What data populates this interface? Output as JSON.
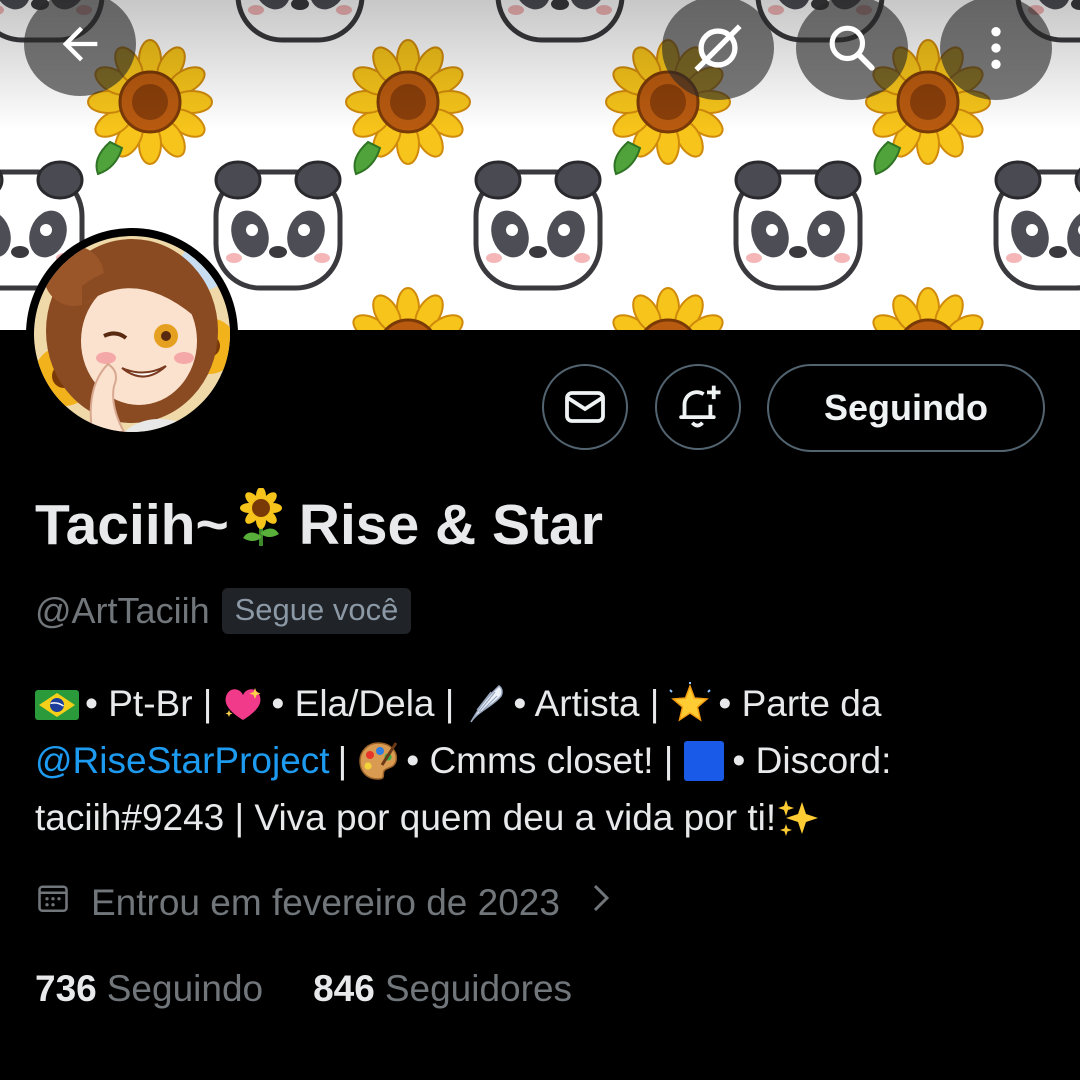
{
  "header": {
    "back_icon": "arrow-left-icon",
    "spaces_icon": "spaces-icon",
    "search_icon": "search-icon",
    "more_icon": "more-vertical-icon"
  },
  "banner": {
    "pattern": [
      "panda",
      "sunflower"
    ],
    "background": "#ffffff"
  },
  "profile": {
    "display_name": "Taciih~",
    "display_name_emoji": "sunflower",
    "display_name_suffix": "Rise & Star",
    "handle": "@ArtTaciih",
    "follows_you_badge": "Segue você"
  },
  "actions": {
    "message_icon": "envelope-icon",
    "notify_icon": "bell-plus-icon",
    "follow_label": "Seguindo"
  },
  "bio": {
    "line1": {
      "seg1": "• Pt-Br |",
      "seg2": "• Ela/Dela |",
      "seg3": "• Artista |",
      "seg4": "• Parte da"
    },
    "line2": {
      "mention": "@RiseStarProject",
      "seg1": "|",
      "seg2": "• Cmms closet! |",
      "seg3": "• Discord:"
    },
    "line3": {
      "seg1": "taciih#9243 | Viva por quem deu a vida por ti!"
    },
    "emojis": [
      "brazil-flag",
      "sparkling-heart",
      "wing",
      "glowing-star",
      "artist-palette",
      "blue-square",
      "sparkles"
    ]
  },
  "joined": {
    "text": "Entrou em fevereiro de 2023",
    "icon": "calendar-icon"
  },
  "stats": {
    "following_count": "736",
    "following_label": "Seguindo",
    "followers_count": "846",
    "followers_label": "Seguidores"
  },
  "colors": {
    "background": "#000000",
    "text_primary": "#e7e9ea",
    "text_secondary": "#71767b",
    "link": "#1d9bf0",
    "border": "#536471"
  }
}
